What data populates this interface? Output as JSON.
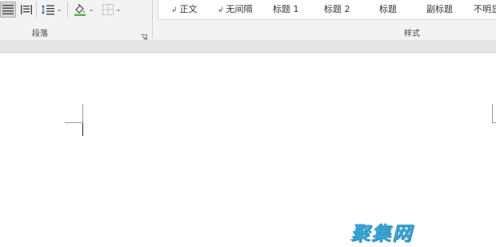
{
  "paragraph_group": {
    "label": "段落"
  },
  "styles_group": {
    "label": "样式",
    "items": [
      {
        "label": "正文",
        "marker": "↲"
      },
      {
        "label": "无间隔",
        "marker": "↲"
      },
      {
        "label": "标题 1",
        "marker": ""
      },
      {
        "label": "标题 2",
        "marker": ""
      },
      {
        "label": "标题",
        "marker": ""
      },
      {
        "label": "副标题",
        "marker": ""
      },
      {
        "label": "不明显强",
        "marker": ""
      }
    ]
  },
  "icons": {
    "justify": "justify-icon",
    "distributed": "distributed-icon",
    "line_spacing": "line-spacing-icon",
    "shading": "shading-icon",
    "borders": "borders-icon",
    "launcher": "dialog-launcher-icon"
  },
  "colors": {
    "shading_bar": "#5bb33f",
    "watermark": "#3aa6d6"
  },
  "watermark": {
    "text": "聚集网"
  }
}
